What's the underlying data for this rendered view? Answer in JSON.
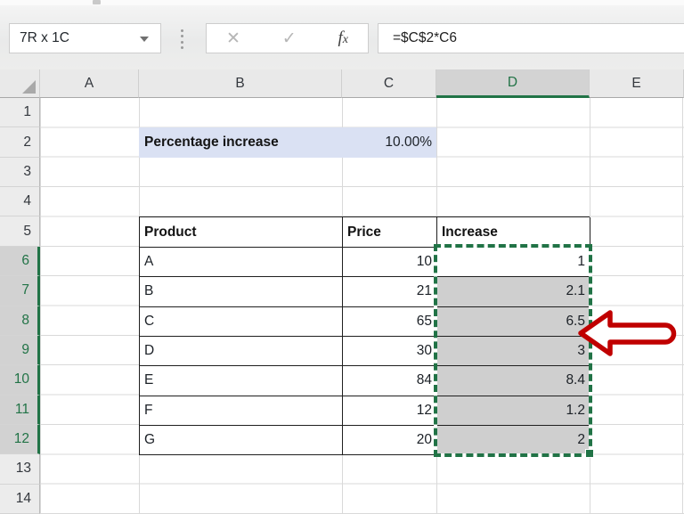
{
  "formula_bar": {
    "name_box_value": "7R x 1C",
    "dropdown_icon": "▾",
    "cancel_icon": "✕",
    "enter_icon": "✓",
    "fx_f": "f",
    "fx_x": "x",
    "formula_value": "=$C$2*C6"
  },
  "grid": {
    "columns": [
      "A",
      "B",
      "C",
      "D",
      "E"
    ],
    "selected_column": "D",
    "rows": [
      "1",
      "2",
      "3",
      "4",
      "5",
      "6",
      "7",
      "8",
      "9",
      "10",
      "11",
      "12",
      "13",
      "14"
    ],
    "selected_rows": [
      "6",
      "7",
      "8",
      "9",
      "10",
      "11",
      "12"
    ],
    "selected_range": "D6:D12"
  },
  "sheet": {
    "percentage_label": "Percentage increase",
    "percentage_value": "10.00%",
    "table": {
      "headers": {
        "product": "Product",
        "price": "Price",
        "increase": "Increase"
      },
      "rows": [
        {
          "product": "A",
          "price": "10",
          "increase": "1"
        },
        {
          "product": "B",
          "price": "21",
          "increase": "2.1"
        },
        {
          "product": "C",
          "price": "65",
          "increase": "6.5"
        },
        {
          "product": "D",
          "price": "30",
          "increase": "3"
        },
        {
          "product": "E",
          "price": "84",
          "increase": "8.4"
        },
        {
          "product": "F",
          "price": "12",
          "increase": "1.2"
        },
        {
          "product": "G",
          "price": "20",
          "increase": "2"
        }
      ]
    }
  },
  "colors": {
    "excel_green": "#217346",
    "selection_fill": "#cfcfcf",
    "highlight_fill": "#dae1f3",
    "arrow_red": "#c00000"
  }
}
